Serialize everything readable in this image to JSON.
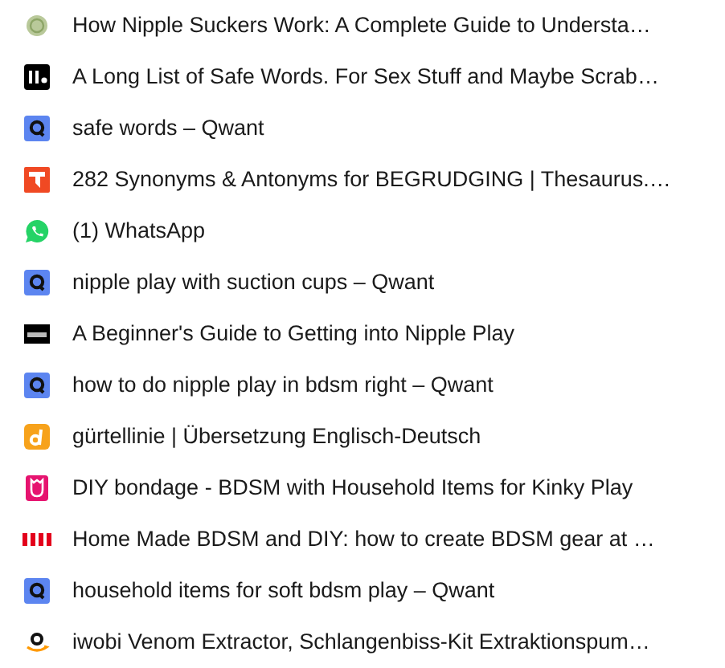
{
  "history": [
    {
      "title": "How Nipple Suckers Work: A Complete Guide to Understa…"
    },
    {
      "title": "A Long List of Safe Words. For Sex Stuff and Maybe Scrab…"
    },
    {
      "title": "safe words – Qwant"
    },
    {
      "title": "282 Synonyms & Antonyms for BEGRUDGING | Thesaurus.…"
    },
    {
      "title": "(1) WhatsApp"
    },
    {
      "title": "nipple play with suction cups – Qwant"
    },
    {
      "title": "A Beginner's Guide to Getting into Nipple Play"
    },
    {
      "title": "how to do nipple play in bdsm right – Qwant"
    },
    {
      "title": "gürtellinie | Übersetzung Englisch-Deutsch"
    },
    {
      "title": "DIY bondage - BDSM with Household Items for Kinky Play"
    },
    {
      "title": "Home Made BDSM and DIY: how to create BDSM gear at …"
    },
    {
      "title": "household items for soft bdsm play – Qwant"
    },
    {
      "title": "iwobi Venom Extractor, Schlangenbiss-Kit Extraktionspum…"
    }
  ]
}
